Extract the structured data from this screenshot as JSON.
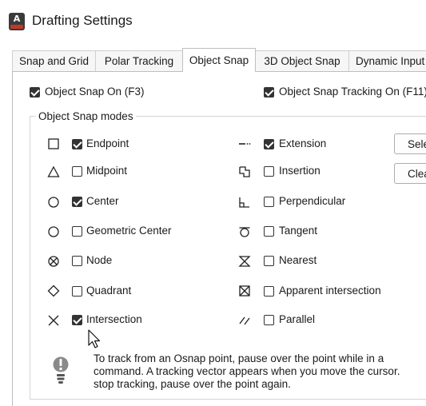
{
  "window": {
    "title": "Drafting Settings",
    "app_icon_letter": "A"
  },
  "tabs": [
    {
      "label": "Snap and Grid",
      "active": false
    },
    {
      "label": "Polar Tracking",
      "active": false
    },
    {
      "label": "Object Snap",
      "active": true
    },
    {
      "label": "3D Object Snap",
      "active": false
    },
    {
      "label": "Dynamic Input",
      "active": false
    }
  ],
  "toggles": {
    "object_snap_on": {
      "label": "Object Snap On (F3)",
      "checked": true
    },
    "object_snap_tracking_on": {
      "label": "Object Snap Tracking On (F11)",
      "checked": true
    }
  },
  "modes": {
    "title": "Object Snap modes",
    "left": [
      {
        "label": "Endpoint",
        "checked": true,
        "icon": "square-icon"
      },
      {
        "label": "Midpoint",
        "checked": false,
        "icon": "triangle-icon"
      },
      {
        "label": "Center",
        "checked": true,
        "icon": "circle-icon"
      },
      {
        "label": "Geometric Center",
        "checked": false,
        "icon": "circle-icon"
      },
      {
        "label": "Node",
        "checked": false,
        "icon": "node-icon"
      },
      {
        "label": "Quadrant",
        "checked": false,
        "icon": "diamond-icon"
      },
      {
        "label": "Intersection",
        "checked": true,
        "icon": "x-icon"
      }
    ],
    "right": [
      {
        "label": "Extension",
        "checked": true,
        "icon": "extension-icon"
      },
      {
        "label": "Insertion",
        "checked": false,
        "icon": "insertion-icon"
      },
      {
        "label": "Perpendicular",
        "checked": false,
        "icon": "perpendicular-icon"
      },
      {
        "label": "Tangent",
        "checked": false,
        "icon": "tangent-icon"
      },
      {
        "label": "Nearest",
        "checked": false,
        "icon": "nearest-icon"
      },
      {
        "label": "Apparent intersection",
        "checked": false,
        "icon": "apparent-intersection-icon"
      },
      {
        "label": "Parallel",
        "checked": false,
        "icon": "parallel-icon"
      }
    ]
  },
  "buttons": {
    "select_all": "Select All",
    "clear_all": "Clear All"
  },
  "hint": {
    "icon": "lightbulb-icon",
    "line1": "To track from an Osnap point, pause over the point while in a",
    "line2": "command.  A tracking vector appears when you move the cursor.",
    "line3": "stop tracking, pause over the point again."
  },
  "colors": {
    "checkbox_checked": "#333333",
    "border": "#bfbfbf",
    "tab_inactive": "#f6f6f6"
  }
}
